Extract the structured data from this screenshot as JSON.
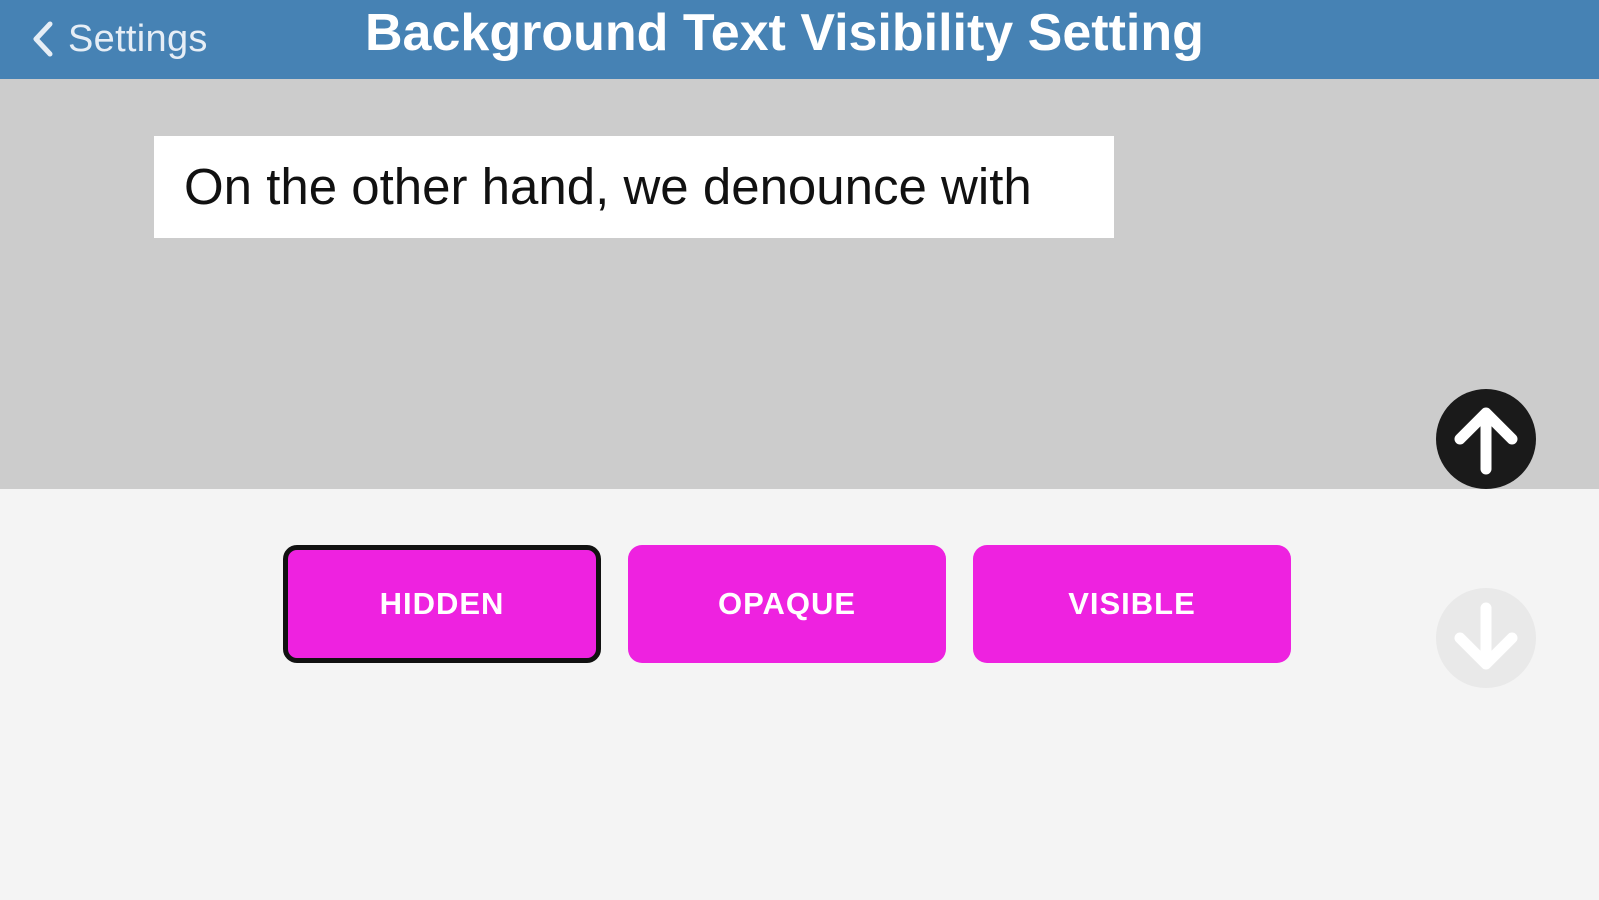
{
  "navbar": {
    "back_label": "Settings",
    "back_icon": "chevron-left-icon",
    "title": "Background Text Visibility Setting",
    "background_color": "#4682b4"
  },
  "preview": {
    "sample_text": "On the other hand, we denounce with",
    "background_color": "#cccccc",
    "text_box_color": "#ffffff"
  },
  "scroll_buttons": {
    "up_icon": "arrow-up-icon",
    "down_icon": "arrow-down-icon",
    "down_enabled": false
  },
  "options": {
    "items": [
      {
        "label": "HIDDEN",
        "selected": true
      },
      {
        "label": "OPAQUE",
        "selected": false
      },
      {
        "label": "VISIBLE",
        "selected": false
      }
    ],
    "button_color": "#ee22e0"
  }
}
